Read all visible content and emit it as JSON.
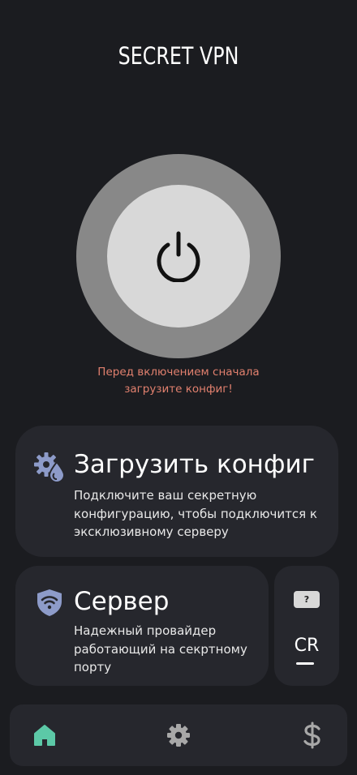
{
  "header": {
    "title": "SECRET VPN"
  },
  "power": {
    "state": "off",
    "icon": "power-icon"
  },
  "warning": {
    "line1": "Перед включением сначала",
    "line2": "загрузите конфиг!"
  },
  "config_card": {
    "icon": "gear-drop-icon",
    "title": "Загрузить конфиг",
    "desc_line1": "Подключите ваш секретную",
    "desc_line2": "конфигурацию, чтобы подключится к",
    "desc_line3": "эксклюзивному серверу"
  },
  "server_card": {
    "icon": "shield-wifi-icon",
    "title": "Сервер",
    "desc_line1": "Надежный провайдер",
    "desc_line2": "работающий на секртному",
    "desc_line3": "порту"
  },
  "country_card": {
    "flag_placeholder": "?",
    "code": "CR"
  },
  "navbar": {
    "items": [
      {
        "icon": "home-icon",
        "active": true
      },
      {
        "icon": "gear-icon",
        "active": false
      },
      {
        "icon": "dollar-icon",
        "active": false
      }
    ]
  },
  "colors": {
    "background": "#1b1c20",
    "card": "#26272d",
    "warning": "#e1806e",
    "accent": "#5cc9a7",
    "icon_blue": "#8d9bc9",
    "inactive_icon": "#a8a8a8"
  }
}
